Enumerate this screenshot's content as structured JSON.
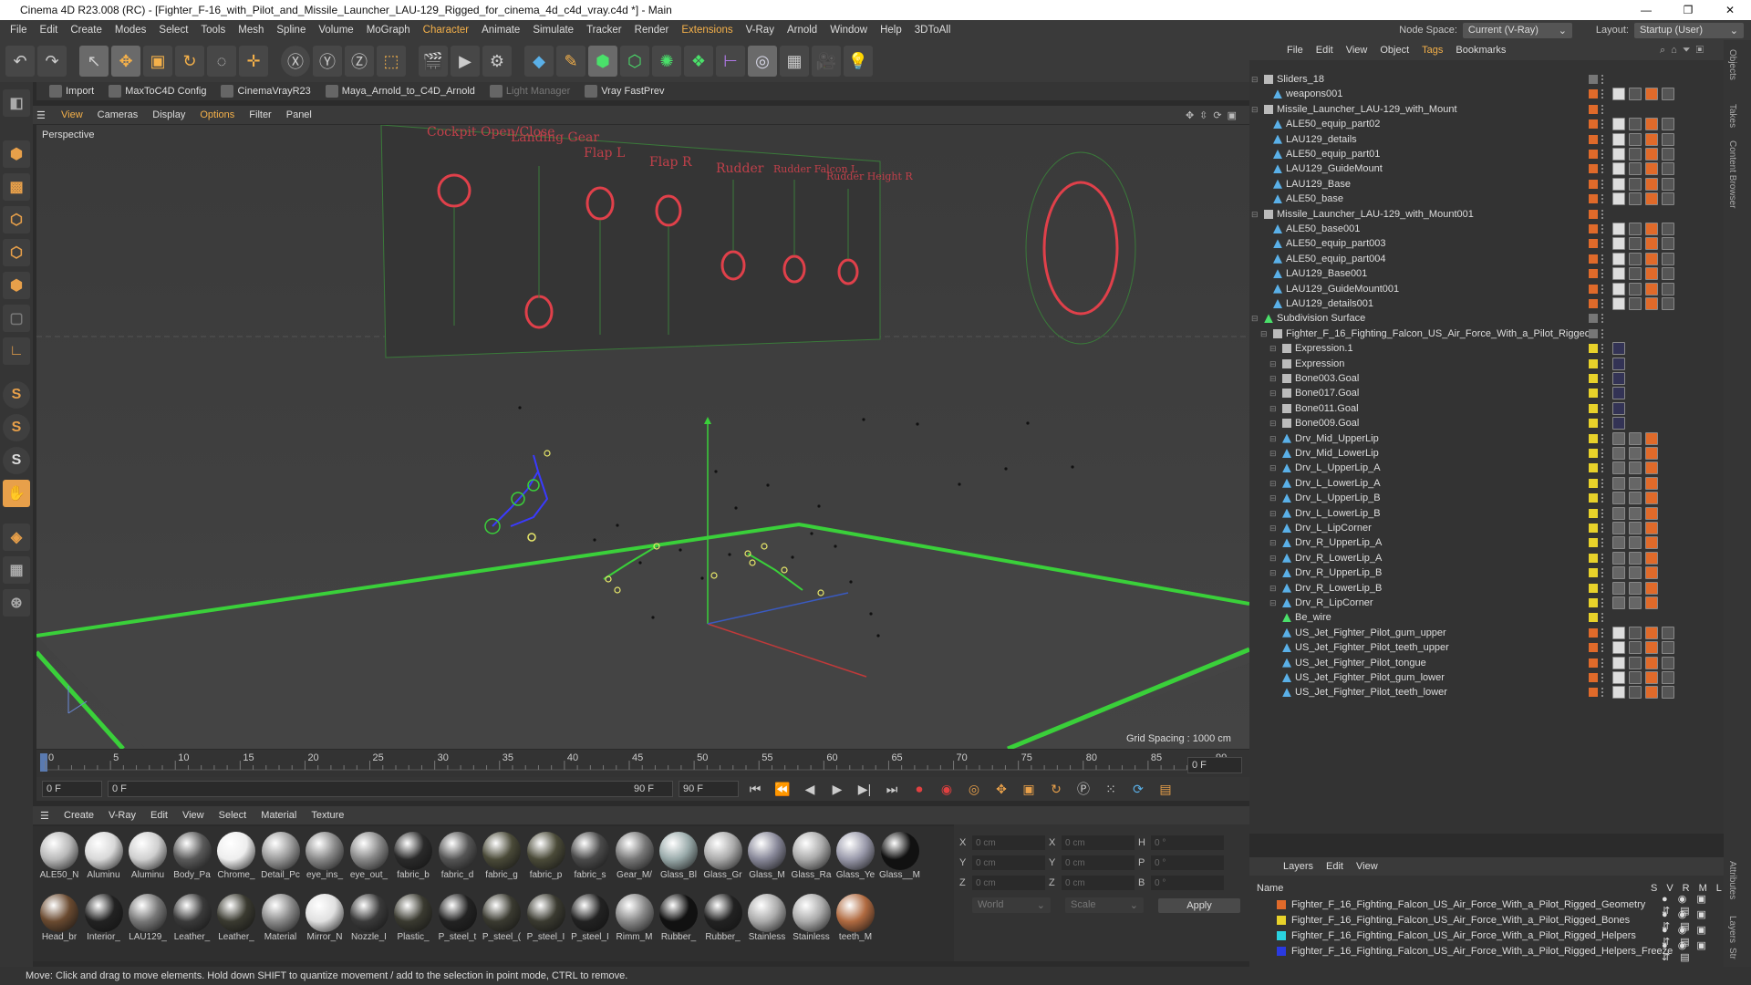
{
  "window": {
    "title": "Cinema 4D R23.008 (RC) - [Fighter_F-16_with_Pilot_and_Missile_Launcher_LAU-129_Rigged_for_cinema_4d_c4d_vray.c4d *] - Main",
    "controls": [
      "—",
      "❐",
      "✕"
    ]
  },
  "menubar": {
    "items": [
      "File",
      "Edit",
      "Create",
      "Modes",
      "Select",
      "Tools",
      "Mesh",
      "Spline",
      "Volume",
      "MoGraph",
      "Character",
      "Animate",
      "Simulate",
      "Tracker",
      "Render",
      "Extensions",
      "V-Ray",
      "Arnold",
      "Window",
      "Help",
      "3DToAll"
    ],
    "node_space_label": "Node Space:",
    "node_space_value": "Current (V-Ray)",
    "layout_label": "Layout:",
    "layout_value": "Startup (User)"
  },
  "plugins": {
    "items": [
      "Import",
      "MaxToC4D Config",
      "CinemaVrayR23",
      "Maya_Arnold_to_C4D_Arnold",
      "Light Manager",
      "Vray FastPrev"
    ]
  },
  "viewport": {
    "menu": [
      "View",
      "Cameras",
      "Display",
      "Options",
      "Filter",
      "Panel"
    ],
    "label": "Perspective",
    "grid_spacing": "Grid Spacing : 1000 cm",
    "panel_labels": [
      "Cockpit Open/Close",
      "Landing Gear",
      "Flap L",
      "Flap R",
      "Rudder",
      "Rudder Falcon L",
      "Rudder Height R"
    ]
  },
  "timeline": {
    "ticks": [
      "0",
      "5",
      "10",
      "15",
      "20",
      "25",
      "30",
      "35",
      "40",
      "45",
      "50",
      "55",
      "60",
      "65",
      "70",
      "75",
      "80",
      "85",
      "90"
    ],
    "current_frame": "0 F",
    "start_field": "0 F",
    "range_field": "0 F",
    "end_field": "90 F",
    "end_field2": "90 F"
  },
  "materials": {
    "menu": [
      "Create",
      "V-Ray",
      "Edit",
      "View",
      "Select",
      "Material",
      "Texture"
    ],
    "row1": [
      "ALE50_N",
      "Aluminu",
      "Aluminu",
      "Body_Pa",
      "Chrome_",
      "Detail_Pc",
      "eye_ins_",
      "eye_out_",
      "fabric_b",
      "fabric_d",
      "fabric_g",
      "fabric_p",
      "fabric_s",
      "Gear_M/",
      "Glass_Bl",
      "Glass_Gr",
      "Glass_M",
      "Glass_Ra",
      "Glass_Ye",
      "Glass__M"
    ],
    "row2": [
      "Head_br",
      "Interior_",
      "LAU129_",
      "Leather_",
      "Leather_",
      "Material",
      "Mirror_N",
      "Nozzle_I",
      "Plastic_",
      "P_steel_t",
      "P_steel_(",
      "P_steel_I",
      "P_steel_I",
      "Rimm_M",
      "Rubber_",
      "Rubber_",
      "Stainless",
      "Stainless",
      "teeth_M"
    ]
  },
  "coords": {
    "labels_left": [
      "X",
      "Y",
      "Z"
    ],
    "labels_mid": [
      "X",
      "Y",
      "Z"
    ],
    "labels_right": [
      "H",
      "P",
      "B"
    ],
    "values_left": [
      "0 cm",
      "0 cm",
      "0 cm"
    ],
    "values_mid": [
      "0 cm",
      "0 cm",
      "0 cm"
    ],
    "values_right": [
      "0 °",
      "0 °",
      "0 °"
    ],
    "world": "World",
    "scale": "Scale",
    "apply": "Apply"
  },
  "object_manager": {
    "menu": [
      "File",
      "Edit",
      "View",
      "Object",
      "Tags",
      "Bookmarks"
    ],
    "rows": [
      {
        "name": "Sliders_18",
        "depth": 0,
        "kind": "null",
        "color": "#777777"
      },
      {
        "name": "weapons001",
        "depth": 1,
        "kind": "poly",
        "color": "#e06a2a"
      },
      {
        "name": "Missile_Launcher_LAU-129_with_Mount",
        "depth": 0,
        "kind": "null",
        "color": "#e06a2a"
      },
      {
        "name": "ALE50_equip_part02",
        "depth": 1,
        "kind": "poly",
        "color": "#e06a2a"
      },
      {
        "name": "LAU129_details",
        "depth": 1,
        "kind": "poly",
        "color": "#e06a2a"
      },
      {
        "name": "ALE50_equip_part01",
        "depth": 1,
        "kind": "poly",
        "color": "#e06a2a"
      },
      {
        "name": "LAU129_GuideMount",
        "depth": 1,
        "kind": "poly",
        "color": "#e06a2a"
      },
      {
        "name": "LAU129_Base",
        "depth": 1,
        "kind": "poly",
        "color": "#e06a2a"
      },
      {
        "name": "ALE50_base",
        "depth": 1,
        "kind": "poly",
        "color": "#e06a2a"
      },
      {
        "name": "Missile_Launcher_LAU-129_with_Mount001",
        "depth": 0,
        "kind": "null",
        "color": "#e06a2a"
      },
      {
        "name": "ALE50_base001",
        "depth": 1,
        "kind": "poly",
        "color": "#e06a2a"
      },
      {
        "name": "ALE50_equip_part003",
        "depth": 1,
        "kind": "poly",
        "color": "#e06a2a"
      },
      {
        "name": "ALE50_equip_part004",
        "depth": 1,
        "kind": "poly",
        "color": "#e06a2a"
      },
      {
        "name": "LAU129_Base001",
        "depth": 1,
        "kind": "poly",
        "color": "#e06a2a"
      },
      {
        "name": "LAU129_GuideMount001",
        "depth": 1,
        "kind": "poly",
        "color": "#e06a2a"
      },
      {
        "name": "LAU129_details001",
        "depth": 1,
        "kind": "poly",
        "color": "#e06a2a"
      },
      {
        "name": "Subdivision Surface",
        "depth": 0,
        "kind": "subd",
        "color": "#777777"
      },
      {
        "name": "Fighter_F_16_Fighting_Falcon_US_Air_Force_With_a_Pilot_Rigged",
        "depth": 1,
        "kind": "null",
        "color": "#777777"
      },
      {
        "name": "Expression.1",
        "depth": 2,
        "kind": "null",
        "color": "#e8d22a"
      },
      {
        "name": "Expression",
        "depth": 2,
        "kind": "null",
        "color": "#e8d22a"
      },
      {
        "name": "Bone003.Goal",
        "depth": 2,
        "kind": "null",
        "color": "#e8d22a"
      },
      {
        "name": "Bone017.Goal",
        "depth": 2,
        "kind": "null",
        "color": "#e8d22a"
      },
      {
        "name": "Bone011.Goal",
        "depth": 2,
        "kind": "null",
        "color": "#e8d22a"
      },
      {
        "name": "Bone009.Goal",
        "depth": 2,
        "kind": "null",
        "color": "#e8d22a"
      },
      {
        "name": "Drv_Mid_UpperLip",
        "depth": 2,
        "kind": "bone",
        "color": "#e8d22a"
      },
      {
        "name": "Drv_Mid_LowerLip",
        "depth": 2,
        "kind": "bone",
        "color": "#e8d22a"
      },
      {
        "name": "Drv_L_UpperLip_A",
        "depth": 2,
        "kind": "bone",
        "color": "#e8d22a"
      },
      {
        "name": "Drv_L_LowerLip_A",
        "depth": 2,
        "kind": "bone",
        "color": "#e8d22a"
      },
      {
        "name": "Drv_L_UpperLip_B",
        "depth": 2,
        "kind": "bone",
        "color": "#e8d22a"
      },
      {
        "name": "Drv_L_LowerLip_B",
        "depth": 2,
        "kind": "bone",
        "color": "#e8d22a"
      },
      {
        "name": "Drv_L_LipCorner",
        "depth": 2,
        "kind": "bone",
        "color": "#e8d22a"
      },
      {
        "name": "Drv_R_UpperLip_A",
        "depth": 2,
        "kind": "bone",
        "color": "#e8d22a"
      },
      {
        "name": "Drv_R_LowerLip_A",
        "depth": 2,
        "kind": "bone",
        "color": "#e8d22a"
      },
      {
        "name": "Drv_R_UpperLip_B",
        "depth": 2,
        "kind": "bone",
        "color": "#e8d22a"
      },
      {
        "name": "Drv_R_LowerLip_B",
        "depth": 2,
        "kind": "bone",
        "color": "#e8d22a"
      },
      {
        "name": "Drv_R_LipCorner",
        "depth": 2,
        "kind": "bone",
        "color": "#e8d22a"
      },
      {
        "name": "Be_wire",
        "depth": 2,
        "kind": "spline",
        "color": "#e8d22a"
      },
      {
        "name": "US_Jet_Fighter_Pilot_gum_upper",
        "depth": 2,
        "kind": "poly",
        "color": "#e06a2a"
      },
      {
        "name": "US_Jet_Fighter_Pilot_teeth_upper",
        "depth": 2,
        "kind": "poly",
        "color": "#e06a2a"
      },
      {
        "name": "US_Jet_Fighter_Pilot_tongue",
        "depth": 2,
        "kind": "poly",
        "color": "#e06a2a"
      },
      {
        "name": "US_Jet_Fighter_Pilot_gum_lower",
        "depth": 2,
        "kind": "poly",
        "color": "#e06a2a"
      },
      {
        "name": "US_Jet_Fighter_Pilot_teeth_lower",
        "depth": 2,
        "kind": "poly",
        "color": "#e06a2a"
      }
    ]
  },
  "layers": {
    "menu": [
      "Layers",
      "Edit",
      "View"
    ],
    "header_name": "Name",
    "header_cols": [
      "S",
      "V",
      "R",
      "M",
      "L"
    ],
    "rows": [
      {
        "name": "Fighter_F_16_Fighting_Falcon_US_Air_Force_With_a_Pilot_Rigged_Geometry",
        "color": "#e06a2a"
      },
      {
        "name": "Fighter_F_16_Fighting_Falcon_US_Air_Force_With_a_Pilot_Rigged_Bones",
        "color": "#e8d22a"
      },
      {
        "name": "Fighter_F_16_Fighting_Falcon_US_Air_Force_With_a_Pilot_Rigged_Helpers",
        "color": "#2ad2e0"
      },
      {
        "name": "Fighter_F_16_Fighting_Falcon_US_Air_Force_With_a_Pilot_Rigged_Helpers_Freeze",
        "color": "#2a3ae0"
      }
    ]
  },
  "right_tabs": [
    "Objects",
    "Takes",
    "Content Browser",
    "Attributes",
    "Layers",
    "Str"
  ],
  "status": "Move: Click and drag to move elements. Hold down SHIFT to quantize movement / add to the selection in point mode, CTRL to remove."
}
